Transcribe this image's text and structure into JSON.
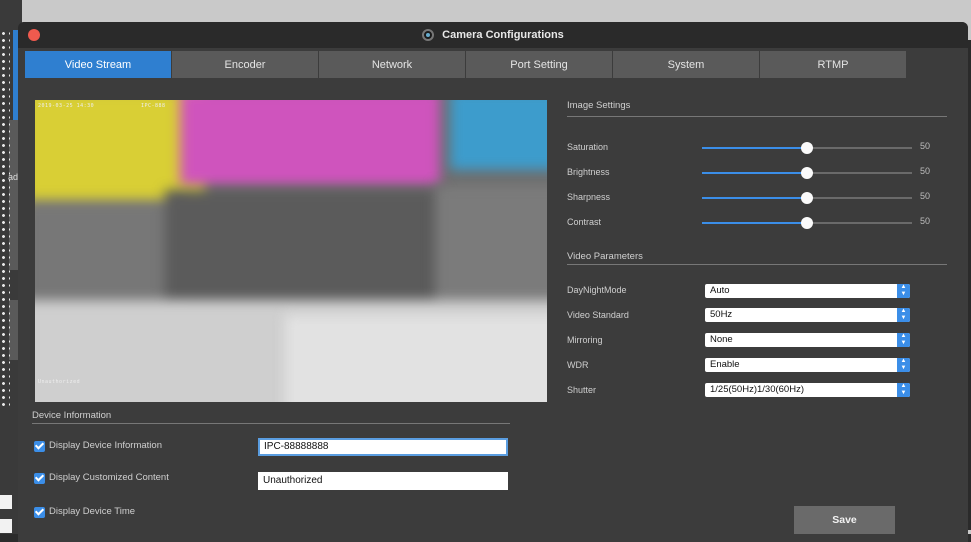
{
  "window": {
    "title": "Camera Configurations"
  },
  "tabs": [
    {
      "label": "Video Stream",
      "active": true
    },
    {
      "label": "Encoder",
      "active": false
    },
    {
      "label": "Network",
      "active": false
    },
    {
      "label": "Port Setting",
      "active": false
    },
    {
      "label": "System",
      "active": false
    },
    {
      "label": "RTMP",
      "active": false
    }
  ],
  "preview": {
    "osd_top_left": "2019-03-25 14:30",
    "osd_top_mid": "IPC-888",
    "osd_bottom_left": "Unauthorized"
  },
  "image_settings": {
    "title": "Image Settings",
    "sliders": [
      {
        "label": "Saturation",
        "value": "50",
        "level": 0.5
      },
      {
        "label": "Brightness",
        "value": "50",
        "level": 0.5
      },
      {
        "label": "Sharpness",
        "value": "50",
        "level": 0.5
      },
      {
        "label": "Contrast",
        "value": "50",
        "level": 0.5
      }
    ]
  },
  "video_parameters": {
    "title": "Video Parameters",
    "fields": [
      {
        "label": "DayNightMode",
        "value": "Auto"
      },
      {
        "label": "Video Standard",
        "value": "50Hz"
      },
      {
        "label": "Mirroring",
        "value": "None"
      },
      {
        "label": "WDR",
        "value": "Enable"
      },
      {
        "label": "Shutter",
        "value": "1/25(50Hz)1/30(60Hz)"
      }
    ]
  },
  "device_info": {
    "title": "Device Information",
    "options": [
      {
        "label": "Display Device Information",
        "checked": true,
        "input_value": "IPC-88888888"
      },
      {
        "label": "Display Customized Content",
        "checked": true,
        "input_value": "Unauthorized"
      },
      {
        "label": "Display Device Time",
        "checked": true
      }
    ]
  },
  "actions": {
    "save_label": "Save"
  },
  "colors": {
    "accent": "#2f7fd0",
    "slider_fill": "#3b8ee8",
    "background": "#3c3c3c",
    "close": "#ef5a4e"
  },
  "backdrop": {
    "side_text": "ad"
  }
}
